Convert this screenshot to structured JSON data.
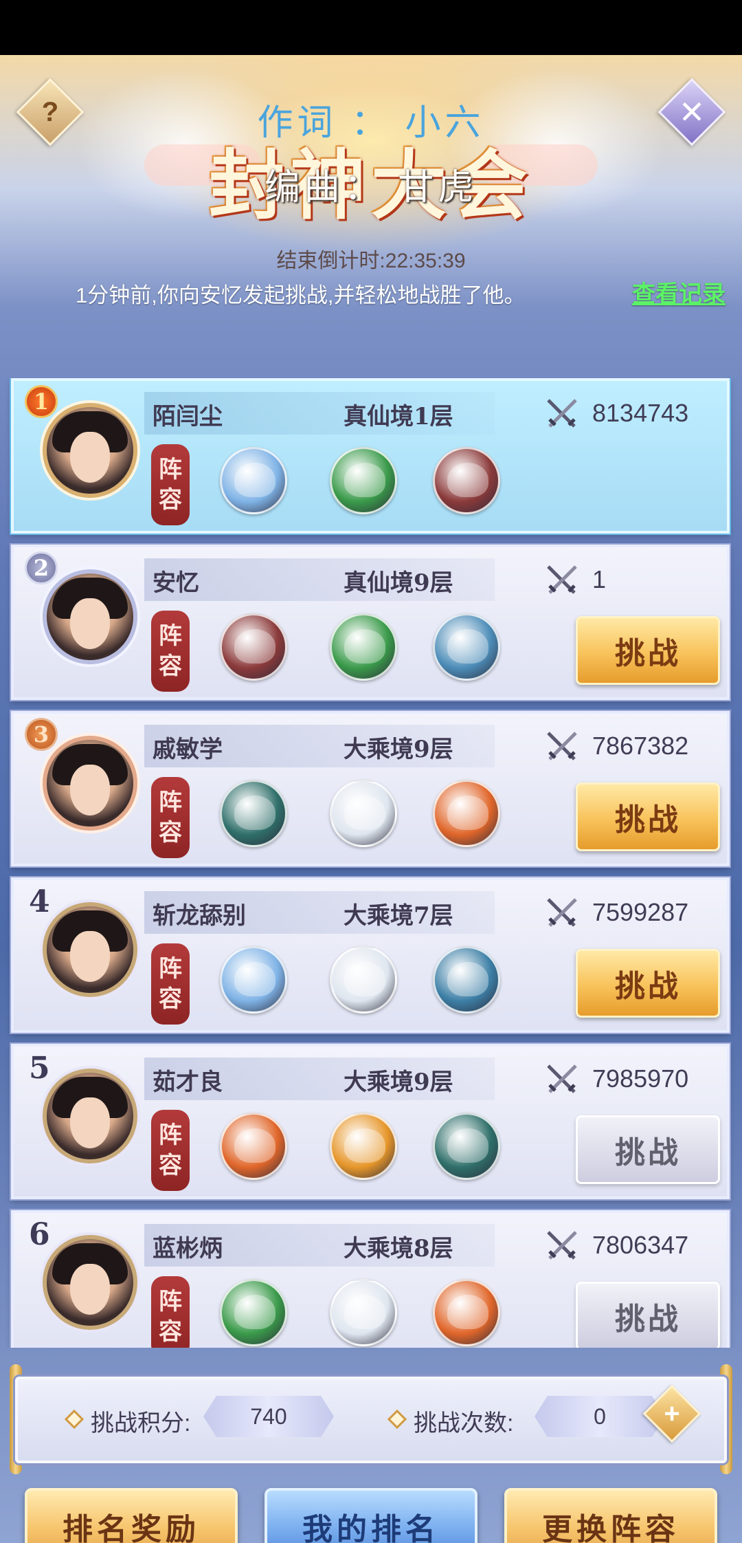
{
  "header": {
    "title": "封神大会",
    "lyric_line1": "作词 ： 小六",
    "lyric_line2": "编曲： 甘虎",
    "help_label": "?",
    "close_label": "✕"
  },
  "countdown": "结束倒计时:22:35:39",
  "notice": "1分钟前,你向安忆发起挑战,并轻松地战胜了他。",
  "view_record": "查看记录",
  "lineup_label": [
    "阵",
    "容"
  ],
  "colors": {
    "challenge_active": "#f8c25a",
    "challenge_disabled": "#cdcde0",
    "first_card": "#a7dcf5",
    "record_link": "#5cf267"
  },
  "ranking": [
    {
      "rank": "1",
      "name": "陌闫尘",
      "realm": "真仙境1层",
      "power": "8134743",
      "button": "",
      "pets": [
        "ice-dragon",
        "green-dragon",
        "fire-dragon"
      ],
      "pet_colors": [
        "#7fb3e6",
        "#3a9a4a",
        "#8b3a3a"
      ]
    },
    {
      "rank": "2",
      "name": "安忆",
      "realm": "真仙境9层",
      "power": "1",
      "button": "挑战",
      "button_state": "active",
      "pets": [
        "fire-dragon",
        "green-dragon",
        "jade-dragon"
      ],
      "pet_colors": [
        "#8b3a3a",
        "#3a9a4a",
        "#4c8cb8"
      ]
    },
    {
      "rank": "3",
      "name": "戚敏学",
      "realm": "大乘境9层",
      "power": "7867382",
      "button": "挑战",
      "button_state": "active",
      "pets": [
        "teal-dragon",
        "white-tiger",
        "phoenix"
      ],
      "pet_colors": [
        "#2f6f6a",
        "#dfe6ef",
        "#e0662a"
      ]
    },
    {
      "rank": "4",
      "name": "斩龙舔别",
      "realm": "大乘境7层",
      "power": "7599287",
      "button": "挑战",
      "button_state": "active",
      "pets": [
        "ice-dragon",
        "white-tiger",
        "blue-whale"
      ],
      "pet_colors": [
        "#7fb3e6",
        "#dfe6ef",
        "#3d7fa6"
      ]
    },
    {
      "rank": "5",
      "name": "茹才良",
      "realm": "大乘境9层",
      "power": "7985970",
      "button": "挑战",
      "button_state": "disabled",
      "pets": [
        "phoenix",
        "golden-dragon",
        "teal-dragon"
      ],
      "pet_colors": [
        "#e0662a",
        "#e6962a",
        "#2f6f6a"
      ]
    },
    {
      "rank": "6",
      "name": "蓝彬炳",
      "realm": "大乘境8层",
      "power": "7806347",
      "button": "挑战",
      "button_state": "disabled",
      "pets": [
        "green-dragon",
        "white-tiger",
        "phoenix"
      ],
      "pet_colors": [
        "#3a9a4a",
        "#dfe6ef",
        "#e0662a"
      ]
    }
  ],
  "stats": {
    "score_label": "挑战积分:",
    "score_value": "740",
    "count_label": "挑战次数:",
    "count_value": "0",
    "plus_label": "+"
  },
  "bottom": {
    "reward": "排名奖励",
    "my_rank": "我的排名",
    "change_lineup": "更换阵容"
  }
}
